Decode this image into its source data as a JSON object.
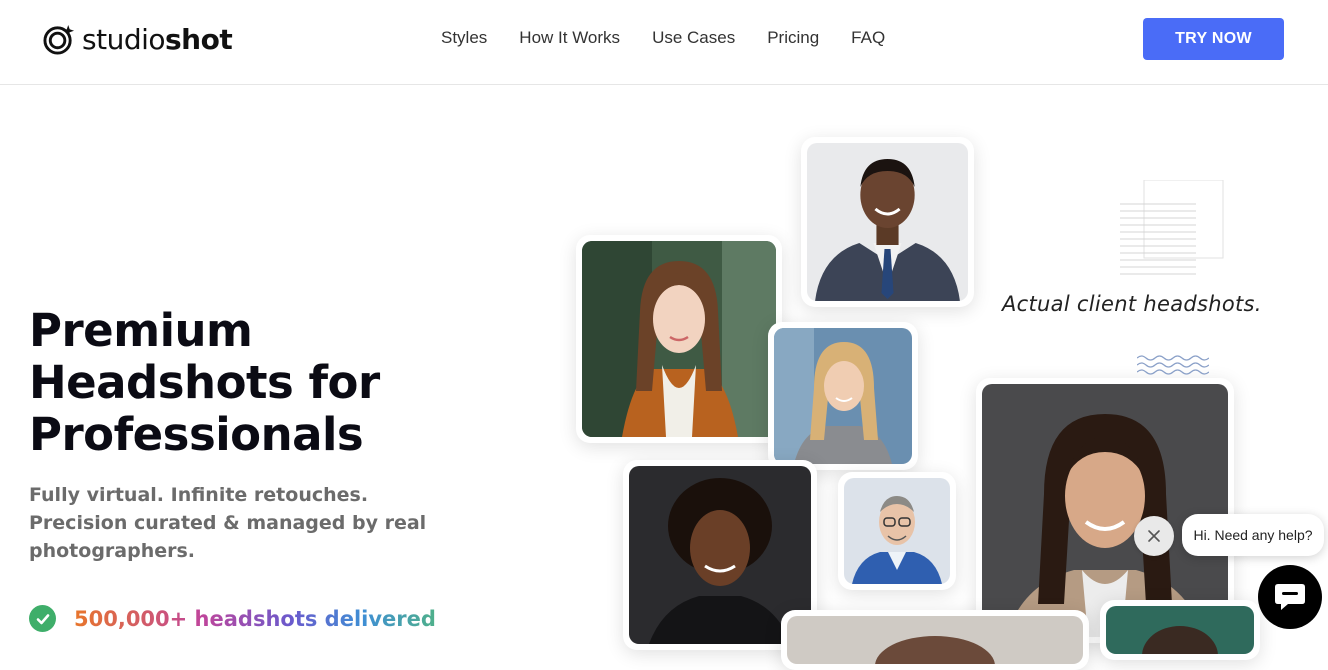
{
  "brand": {
    "name_light": "studio",
    "name_bold": "shot"
  },
  "nav": {
    "items": [
      {
        "label": "Styles"
      },
      {
        "label": "How It Works"
      },
      {
        "label": "Use Cases"
      },
      {
        "label": "Pricing"
      },
      {
        "label": "FAQ"
      }
    ],
    "cta_label": "TRY NOW"
  },
  "hero": {
    "title_line1": "Premium",
    "title_line2": "Headshots for",
    "title_line3": "Professionals",
    "subtitle_line1": "Fully virtual. Infinite retouches.",
    "subtitle_line2": "Precision curated & managed by real",
    "subtitle_line3": "photographers.",
    "delivered_text": "500,000+ headshots delivered"
  },
  "gallery": {
    "caption": "Actual client headshots."
  },
  "chat": {
    "bubble_text": "Hi. Need any help?"
  },
  "colors": {
    "accent": "#4a6cf7",
    "check": "#3fae6a"
  }
}
